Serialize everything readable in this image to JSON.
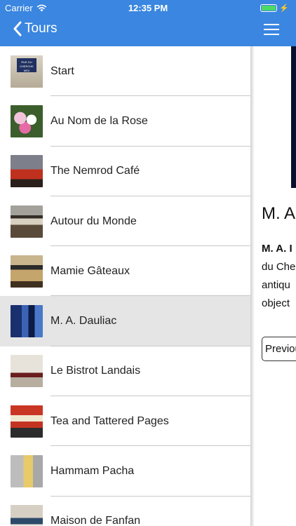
{
  "status_bar": {
    "carrier": "Carrier",
    "time": "12:35 PM",
    "battery_color": "#4cd964"
  },
  "nav": {
    "back_label": "Tours",
    "accent_color": "#3a86e0"
  },
  "tour_stops": [
    {
      "label": "Start",
      "thumb": "street-sign-image"
    },
    {
      "label": "Au Nom de la Rose",
      "thumb": "roses-image"
    },
    {
      "label": "The Nemrod Café",
      "thumb": "cafe-image"
    },
    {
      "label": "Autour du Monde",
      "thumb": "shopfront-image"
    },
    {
      "label": "Mamie Gâteaux",
      "thumb": "shopfront-image"
    },
    {
      "label": "M. A. Dauliac",
      "thumb": "blue-shopfront-image",
      "selected": true
    },
    {
      "label": "Le Bistrot Landais",
      "thumb": "bistro-image"
    },
    {
      "label": "Tea and Tattered Pages",
      "thumb": "tea-shop-image"
    },
    {
      "label": "Hammam Pacha",
      "thumb": "hammam-image"
    },
    {
      "label": "Maison de Fanfan",
      "thumb": "shopfront-image"
    }
  ],
  "detail": {
    "title": "M. A",
    "para_bold": "M. A. I",
    "para_lines": [
      "du Che",
      "antiqu",
      "object"
    ],
    "prev_button": "Previou"
  },
  "start_sign_text": "RUE DU CHERCHE MIDI"
}
